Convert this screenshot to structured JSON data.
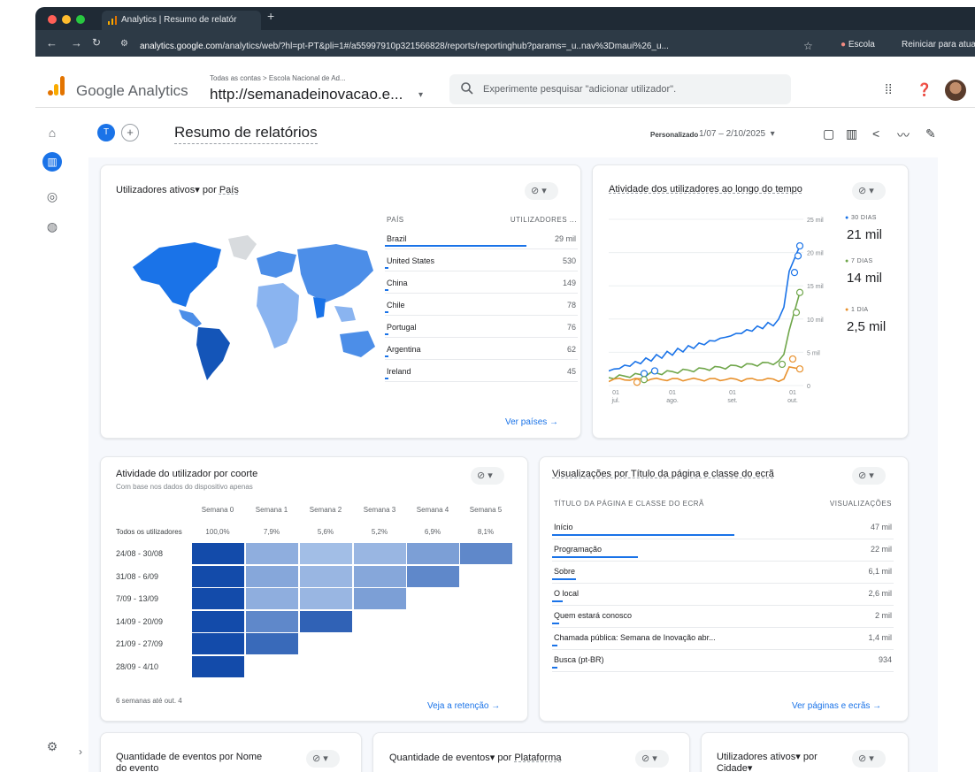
{
  "browser": {
    "tab_title": "Analytics | Resumo de relatór",
    "url_host": "analytics.google.com",
    "url_rest": "/analytics/web/?hl=pt-PT&pli=1#/a55997910p321566828/reports/reportinghub?params=_u..nav%3Dmaui%26_u...",
    "profile": "Escola",
    "update_button": "Reiniciar para atualizar",
    "colors": {
      "chrome_dark": "#1f2a35",
      "chrome_mid": "#2d3a46"
    }
  },
  "header": {
    "brand": "Google Analytics",
    "account_crumb": "Todas as contas > Escola Nacional de Ad...",
    "property": "http://semanadeinovacao.e...",
    "search_placeholder": "Experimente pesquisar \"adicionar utilizador\".",
    "icons": [
      "apps-icon",
      "help-icon",
      "avatar"
    ]
  },
  "rail": {
    "icons": [
      "home-icon",
      "reports-icon",
      "explore-icon",
      "advertising-icon",
      "settings-icon",
      "expand-icon"
    ]
  },
  "subheader": {
    "user_initial": "T",
    "title": "Resumo de relatórios",
    "date_label": "Personalizado",
    "date_range": "1/07 – 2/10/2025"
  },
  "card_countries": {
    "title_metric": "Utilizadores ativos",
    "title_by": "por",
    "title_dim": "País",
    "col_country": "PAÍS",
    "col_users": "UTILIZADORES ...",
    "rows": [
      {
        "name": "Brazil",
        "value": "29 mil",
        "share": 1.0
      },
      {
        "name": "United States",
        "value": "530",
        "share": 0.02
      },
      {
        "name": "China",
        "value": "149",
        "share": 0.01
      },
      {
        "name": "Chile",
        "value": "78",
        "share": 0.0
      },
      {
        "name": "Portugal",
        "value": "76",
        "share": 0.0
      },
      {
        "name": "Argentina",
        "value": "62",
        "share": 0.0
      },
      {
        "name": "Ireland",
        "value": "45",
        "share": 0.0
      }
    ],
    "link": "Ver países"
  },
  "card_activity": {
    "title": "Atividade dos utilizadores ao longo do tempo",
    "legend": [
      {
        "tag": "30 DIAS",
        "value": "21 mil",
        "color": "#1a73e8"
      },
      {
        "tag": "7 DIAS",
        "value": "14 mil",
        "color": "#6fa64a"
      },
      {
        "tag": "1 DIA",
        "value": "2,5 mil",
        "color": "#e8912d"
      }
    ],
    "y_ticks": [
      "25 mil",
      "20 mil",
      "15 mil",
      "10 mil",
      "5 mil",
      "0"
    ],
    "x_ticks": [
      {
        "day": "01",
        "month": "jul."
      },
      {
        "day": "01",
        "month": "ago."
      },
      {
        "day": "01",
        "month": "set."
      },
      {
        "day": "01",
        "month": "out."
      }
    ]
  },
  "card_cohort": {
    "title": "Atividade do utilizador por coorte",
    "subtitle": "Com base nos dados do dispositivo apenas",
    "weeks": [
      "Semana 0",
      "Semana 1",
      "Semana 2",
      "Semana 3",
      "Semana 4",
      "Semana 5"
    ],
    "all_users_label": "Todos os utilizadores",
    "all_users_pct": [
      "100,0%",
      "7,9%",
      "5,6%",
      "5,2%",
      "6,9%",
      "8,1%"
    ],
    "rows": [
      {
        "label": "24/08 - 30/08",
        "levels": [
          1.0,
          0.35,
          0.25,
          0.3,
          0.45,
          0.6
        ]
      },
      {
        "label": "31/08 - 6/09",
        "levels": [
          1.0,
          0.4,
          0.3,
          0.4,
          0.6
        ]
      },
      {
        "label": "7/09 - 13/09",
        "levels": [
          1.0,
          0.35,
          0.3,
          0.45
        ]
      },
      {
        "label": "14/09 - 20/09",
        "levels": [
          1.0,
          0.6,
          0.85
        ]
      },
      {
        "label": "21/09 - 27/09",
        "levels": [
          1.0,
          0.8
        ]
      },
      {
        "label": "28/09 - 4/10",
        "levels": [
          1.0
        ]
      }
    ],
    "footer": "6 semanas até out. 4",
    "link": "Veja a retenção"
  },
  "card_pages": {
    "title": "Visualizações por Título da página e classe do ecrã",
    "col_title": "TÍTULO DA PÁGINA E CLASSE DO ECRÃ",
    "col_views": "VISUALIZAÇÕES",
    "rows": [
      {
        "name": "Início",
        "value": "47 mil",
        "share": 1.0
      },
      {
        "name": "Programação",
        "value": "22 mil",
        "share": 0.47
      },
      {
        "name": "Sobre",
        "value": "6,1 mil",
        "share": 0.13
      },
      {
        "name": "O local",
        "value": "2,6 mil",
        "share": 0.06
      },
      {
        "name": "Quem estará conosco",
        "value": "2 mil",
        "share": 0.04
      },
      {
        "name": "Chamada pública: Semana de Inovação abr...",
        "value": "1,4 mil",
        "share": 0.03
      },
      {
        "name": "Busca (pt-BR)",
        "value": "934",
        "share": 0.02
      }
    ],
    "link": "Ver páginas e ecrãs"
  },
  "bottom_cards": {
    "events_by_name": "Quantidade de eventos por Nome do evento",
    "events_by_platform_metric": "Quantidade de eventos",
    "events_by_platform_by": "por",
    "events_by_platform_dim": "Plataforma",
    "users_by_city": "Utilizadores ativos",
    "users_by_city_by": "por",
    "users_by_city_dim": "Cidade"
  }
}
